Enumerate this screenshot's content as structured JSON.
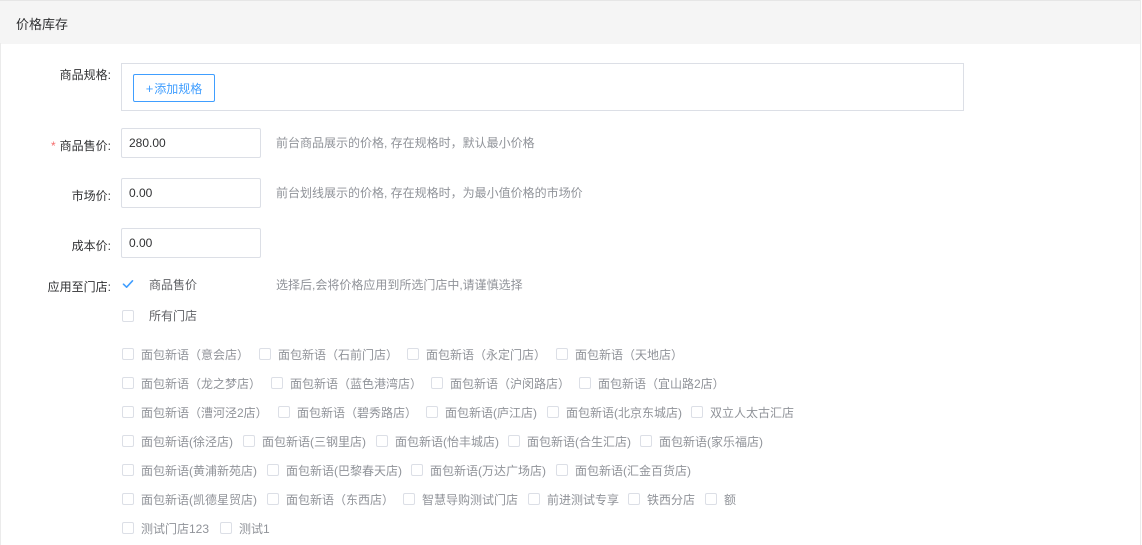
{
  "section": {
    "title": "价格库存"
  },
  "spec": {
    "label": "商品规格:",
    "add_button": "添加规格",
    "add_icon": "+"
  },
  "price": {
    "required_mark": "*",
    "label": "商品售价:",
    "value": "280.00",
    "hint": "前台商品展示的价格, 存在规格时，默认最小价格"
  },
  "market_price": {
    "label": "市场价:",
    "value": "0.00",
    "hint": "前台划线展示的价格, 存在规格时，为最小值价格的市场价"
  },
  "cost_price": {
    "label": "成本价:",
    "value": "0.00"
  },
  "apply_store": {
    "label": "应用至门店:",
    "option_price": {
      "label": "商品售价",
      "checked": true
    },
    "hint": "选择后,会将价格应用到所选门店中,请谨慎选择",
    "option_all": {
      "label": "所有门店",
      "checked": false
    }
  },
  "stores": [
    [
      "面包新语（意会店）",
      "面包新语（石前门店）",
      "面包新语（永定门店）",
      "面包新语（天地店）"
    ],
    [
      "面包新语（龙之梦店）",
      "面包新语（蓝色港湾店）",
      "面包新语（沪闵路店）",
      "面包新语（宜山路2店）"
    ],
    [
      "面包新语（漕河泾2店）",
      "面包新语（碧秀路店）",
      "面包新语(庐江店)",
      "面包新语(北京东城店)",
      "双立人太古汇店"
    ],
    [
      "面包新语(徐泾店)",
      "面包新语(三钢里店)",
      "面包新语(怡丰城店)",
      "面包新语(合生汇店)",
      "面包新语(家乐福店)"
    ],
    [
      "面包新语(黄浦新苑店)",
      "面包新语(巴黎春天店)",
      "面包新语(万达广场店)",
      "面包新语(汇金百货店)"
    ],
    [
      "面包新语(凯德星贸店)",
      "面包新语（东西店）",
      "智慧导购测试门店",
      "前进测试专享",
      "铁西分店",
      "额"
    ],
    [
      "测试门店123",
      "测试1"
    ]
  ],
  "colors": {
    "primary": "#409eff",
    "required": "#f56c6c",
    "border": "#dcdfe6",
    "header_bg": "#f5f5f5"
  },
  "icons": {
    "check": "check-icon",
    "plus": "plus-icon"
  }
}
